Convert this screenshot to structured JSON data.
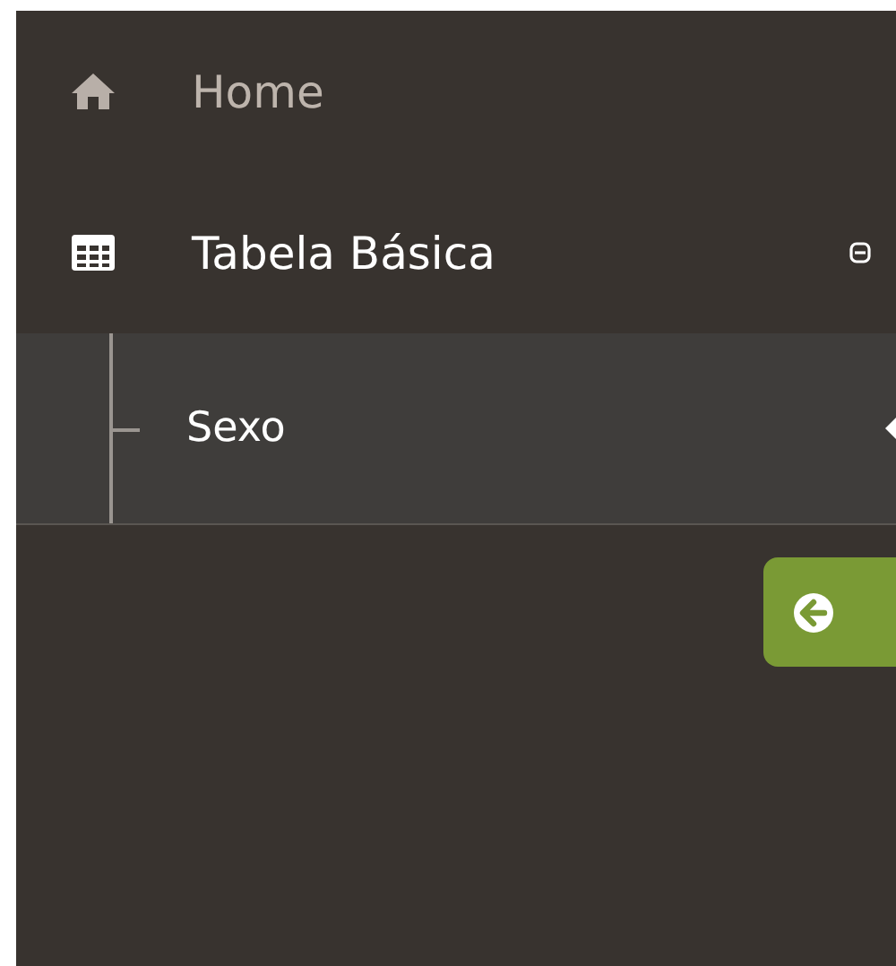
{
  "menu": [
    {
      "kind": "home",
      "label": "Home",
      "selected": false
    },
    {
      "kind": "table",
      "label": "Tabela Básica",
      "selected": false,
      "expanded": true,
      "children": [
        {
          "label": "Sexo",
          "selected": true
        }
      ]
    }
  ],
  "collapse_button": {
    "kind": "back"
  }
}
